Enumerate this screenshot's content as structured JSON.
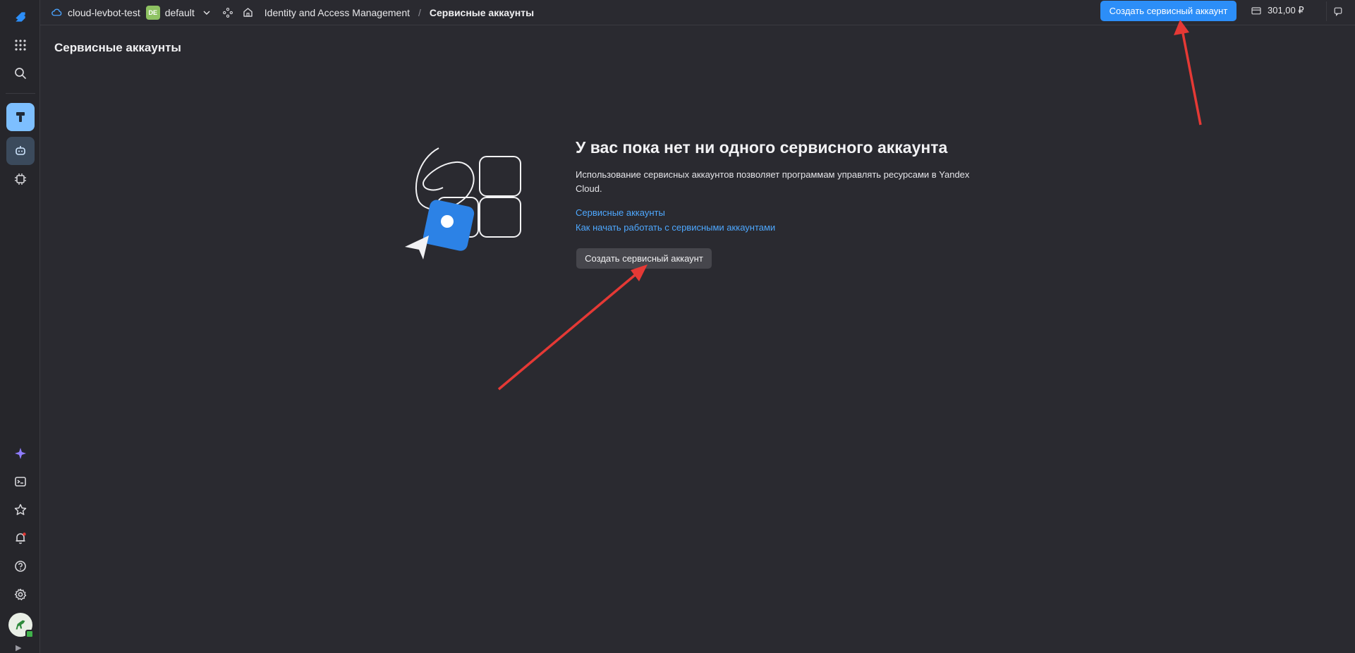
{
  "topbar": {
    "cloud_name": "cloud-levbot-test",
    "folder_badge": "DE",
    "folder_name": "default",
    "service_name": "Identity and Access Management",
    "separator": "/",
    "current_page": "Сервисные аккаунты",
    "create_button_label": "Создать сервисный аккаунт",
    "balance": "301,00 ₽"
  },
  "page": {
    "title": "Сервисные аккаунты"
  },
  "empty_state": {
    "title": "У вас пока нет ни одного сервисного аккаунта",
    "description": "Использование сервисных аккаунтов позволяет программам управлять ресурсами в Yandex Cloud.",
    "links": [
      "Сервисные аккаунты",
      "Как начать работать с сервисными аккаунтами"
    ],
    "create_button_label": "Создать сервисный аккаунт"
  },
  "sidebar": {
    "icons": [
      "logo-icon",
      "apps-icon",
      "search-icon",
      "iam-icon",
      "robot-icon",
      "cpu-icon",
      "ai-sparkle-icon",
      "terminal-icon",
      "star-icon",
      "bell-icon",
      "help-icon",
      "gear-icon",
      "avatar"
    ]
  },
  "colors": {
    "background": "#2a2a30",
    "accent": "#2c8ef8",
    "link": "#4ea8ff",
    "annotation_arrow": "#e53935"
  }
}
